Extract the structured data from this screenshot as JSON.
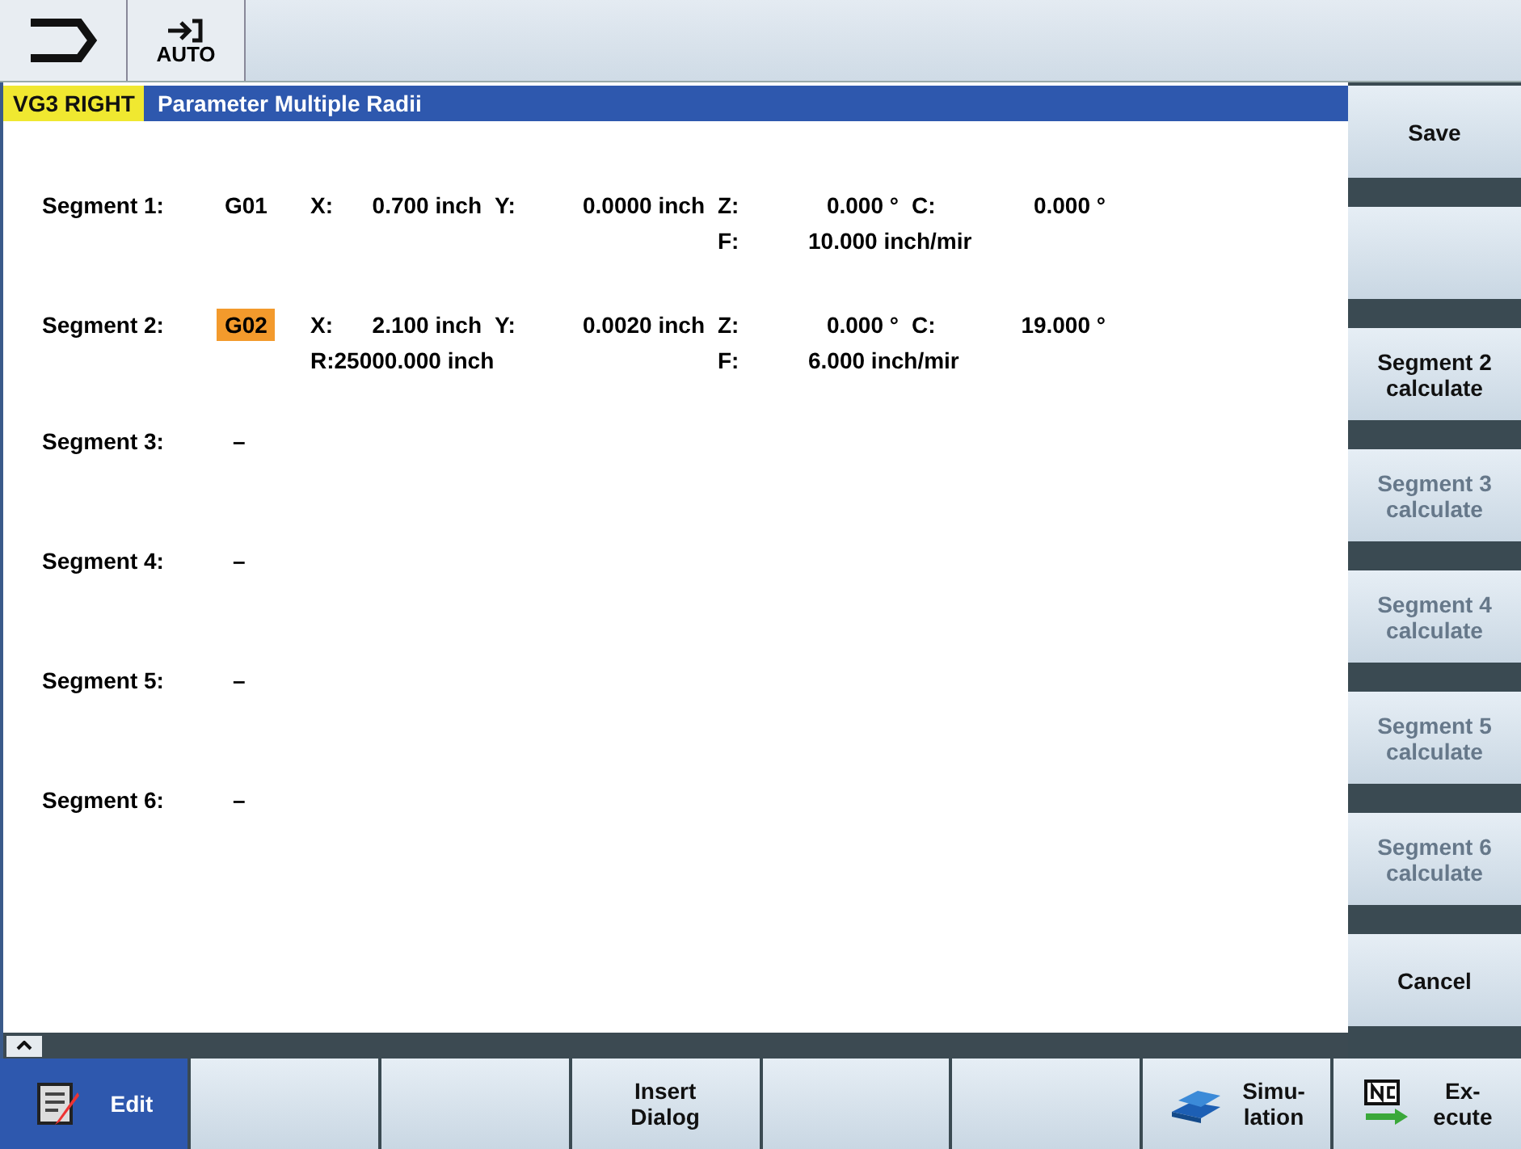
{
  "header": {
    "mode_label": "AUTO"
  },
  "title_bar": {
    "channel": "VG3 RIGHT",
    "title": "Parameter Multiple Radii"
  },
  "segments": [
    {
      "kind": "defined",
      "label": "Segment 1:",
      "code": {
        "text": "G01",
        "selected": false
      },
      "x": {
        "label": "X:",
        "value": "0.700 inch"
      },
      "y": {
        "label": "Y:",
        "value": "0.0000 inch"
      },
      "z": {
        "label": "Z:",
        "value": "0.000 °"
      },
      "c": {
        "label": "C:",
        "value": "0.000 °"
      },
      "f": {
        "label": "F:",
        "value": "10.000 inch/mir"
      }
    },
    {
      "kind": "defined",
      "label": "Segment 2:",
      "code": {
        "text": "G02",
        "selected": true
      },
      "x": {
        "label": "X:",
        "value": "2.100 inch"
      },
      "y": {
        "label": "Y:",
        "value": "0.0020 inch"
      },
      "z": {
        "label": "Z:",
        "value": "0.000 °"
      },
      "c": {
        "label": "C:",
        "value": "19.000 °"
      },
      "r": {
        "label": "R:",
        "value": "25000.000 inch"
      },
      "f": {
        "label": "F:",
        "value": "6.000 inch/mir"
      }
    },
    {
      "kind": "empty",
      "label": "Segment 3:",
      "dash": "–"
    },
    {
      "kind": "empty",
      "label": "Segment 4:",
      "dash": "–"
    },
    {
      "kind": "empty",
      "label": "Segment 5:",
      "dash": "–"
    },
    {
      "kind": "empty",
      "label": "Segment 6:",
      "dash": "–"
    }
  ],
  "side_keys": [
    {
      "kind": "labeled",
      "label": "Save",
      "disabled": false
    },
    {
      "kind": "blank"
    },
    {
      "kind": "labeled",
      "label": "Segment 2\ncalculate",
      "disabled": false
    },
    {
      "kind": "labeled",
      "label": "Segment 3\ncalculate",
      "disabled": true
    },
    {
      "kind": "labeled",
      "label": "Segment 4\ncalculate",
      "disabled": true
    },
    {
      "kind": "labeled",
      "label": "Segment 5\ncalculate",
      "disabled": true
    },
    {
      "kind": "labeled",
      "label": "Segment 6\ncalculate",
      "disabled": true
    },
    {
      "kind": "labeled",
      "label": "Cancel",
      "disabled": false
    }
  ],
  "bottom_keys": [
    {
      "label": "Edit",
      "selected": true
    },
    {
      "selected": false
    },
    {
      "selected": false
    },
    {
      "label": "Insert\nDialog",
      "selected": false
    },
    {
      "selected": false
    },
    {
      "selected": false
    },
    {
      "label": "Simu-\nlation",
      "selected": false
    },
    {
      "label": "Ex-\necute",
      "selected": false
    }
  ]
}
